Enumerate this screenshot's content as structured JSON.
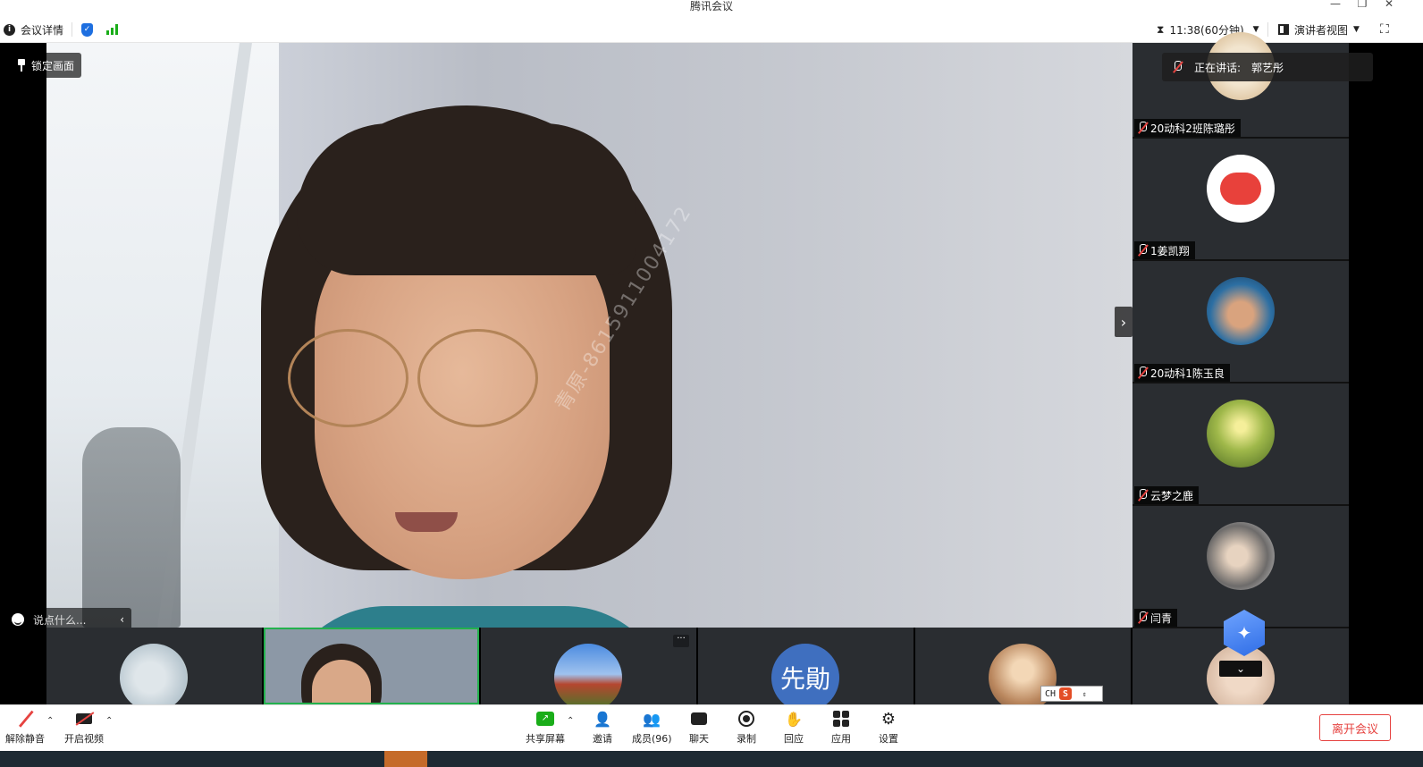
{
  "window": {
    "title": "腾讯会议",
    "controls": {
      "minimize": "—",
      "restore": "❐",
      "close": "✕"
    }
  },
  "infobar": {
    "meeting_details": "会议详情",
    "timer": "11:38(60分钟)",
    "view_mode": "演讲者视图",
    "icons": [
      "info-icon",
      "shield-icon",
      "signal-icon",
      "hourglass-icon",
      "layout-icon",
      "fullscreen-icon"
    ],
    "colors": {
      "shield": "#1e6fe0",
      "signal": "#1aad19"
    }
  },
  "main_video": {
    "lock_label": "锁定画面",
    "watermark": "青原-8615911004172",
    "chat_placeholder": "说点什么..."
  },
  "speaking": {
    "prefix": "正在讲话:",
    "name": "郭艺彤"
  },
  "sidebar": {
    "participants": [
      {
        "name": "20动科2班陈璐彤"
      },
      {
        "name": "1姜凯翔"
      },
      {
        "name": "20动科1陈玉良"
      },
      {
        "name": "云梦之鹿"
      },
      {
        "name": "闫青"
      }
    ]
  },
  "strip": {
    "tiles": [
      {
        "kind": "avatar"
      },
      {
        "kind": "video",
        "active": true
      },
      {
        "kind": "avatar"
      },
      {
        "kind": "text-avatar",
        "text": "先勛"
      },
      {
        "kind": "avatar"
      },
      {
        "kind": "avatar"
      }
    ],
    "more": "···"
  },
  "ime": {
    "lang": "CH",
    "logo": "S"
  },
  "toolbar": {
    "unmute": "解除静音",
    "start_video": "开启视频",
    "share_screen": "共享屏幕",
    "invite": "邀请",
    "members": "成员(96)",
    "chat": "聊天",
    "record": "录制",
    "reactions": "回应",
    "apps": "应用",
    "settings": "设置",
    "leave": "离开会议",
    "colors": {
      "leave": "#e64340",
      "share": "#1aad19"
    }
  }
}
